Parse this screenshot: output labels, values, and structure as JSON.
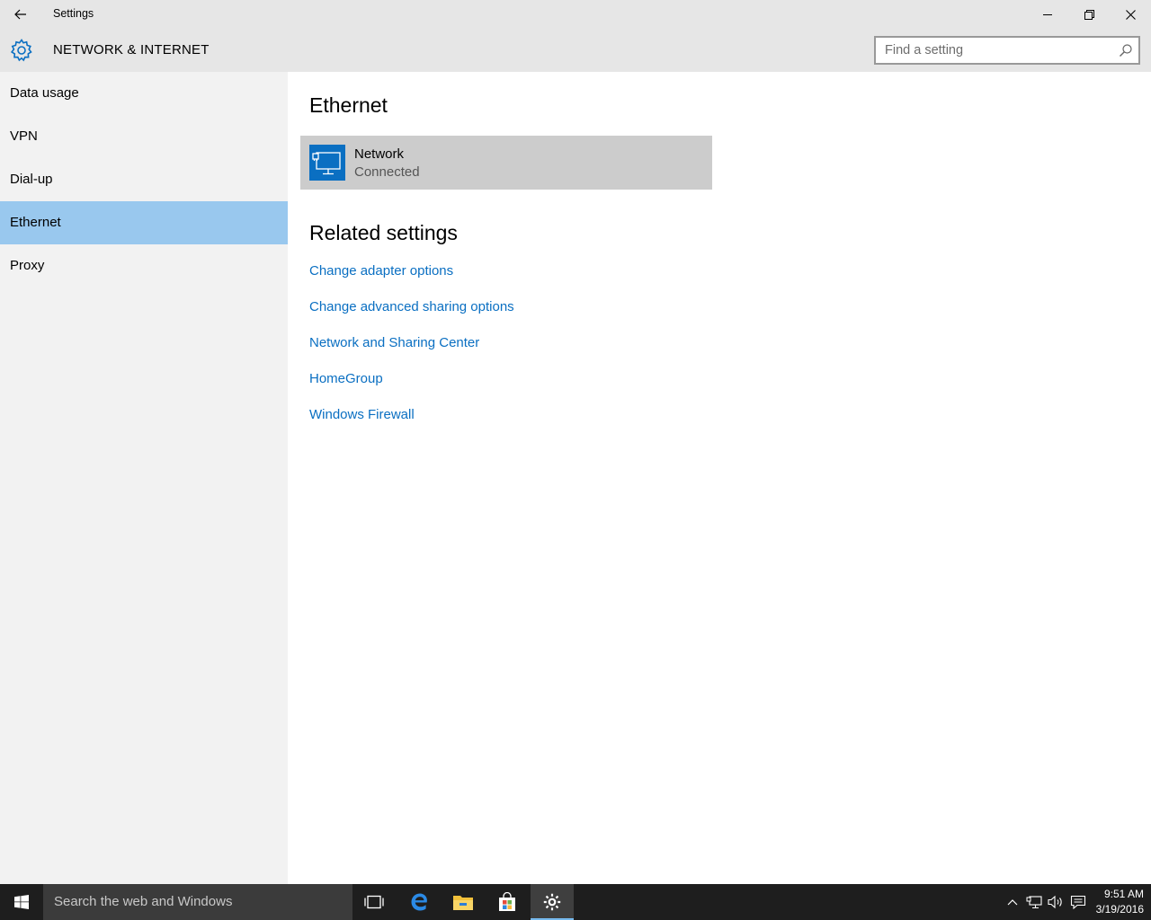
{
  "window": {
    "title": "Settings",
    "back_icon": "back-arrow-icon",
    "minimize_icon": "minimize-icon",
    "restore_icon": "restore-icon",
    "close_icon": "close-icon"
  },
  "header": {
    "icon": "gear-icon",
    "title": "NETWORK & INTERNET",
    "search_placeholder": "Find a setting",
    "search_value": "",
    "search_icon": "search-icon"
  },
  "sidebar": {
    "items": [
      {
        "label": "Data usage"
      },
      {
        "label": "VPN"
      },
      {
        "label": "Dial-up"
      },
      {
        "label": "Ethernet",
        "selected": true
      },
      {
        "label": "Proxy"
      }
    ]
  },
  "main": {
    "heading": "Ethernet",
    "network": {
      "icon": "ethernet-monitor-icon",
      "name": "Network",
      "status": "Connected"
    },
    "related_heading": "Related settings",
    "links": [
      {
        "label": "Change adapter options"
      },
      {
        "label": "Change advanced sharing options"
      },
      {
        "label": "Network and Sharing Center"
      },
      {
        "label": "HomeGroup"
      },
      {
        "label": "Windows Firewall"
      }
    ]
  },
  "taskbar": {
    "search_placeholder": "Search the web and Windows",
    "apps": [
      "task-view-icon",
      "edge-icon",
      "file-explorer-icon",
      "store-icon",
      "settings-icon"
    ],
    "tray": [
      "chevron-up-icon",
      "network-icon",
      "volume-icon",
      "action-center-icon"
    ],
    "time": "9:51 AM",
    "date": "3/19/2016"
  },
  "colors": {
    "accent": "#0a6fc2",
    "sidebar_selected": "#99c8ee",
    "chrome": "#e6e6e6",
    "sidebar_bg": "#f2f2f2",
    "taskbar_bg": "#1e1e1e"
  }
}
